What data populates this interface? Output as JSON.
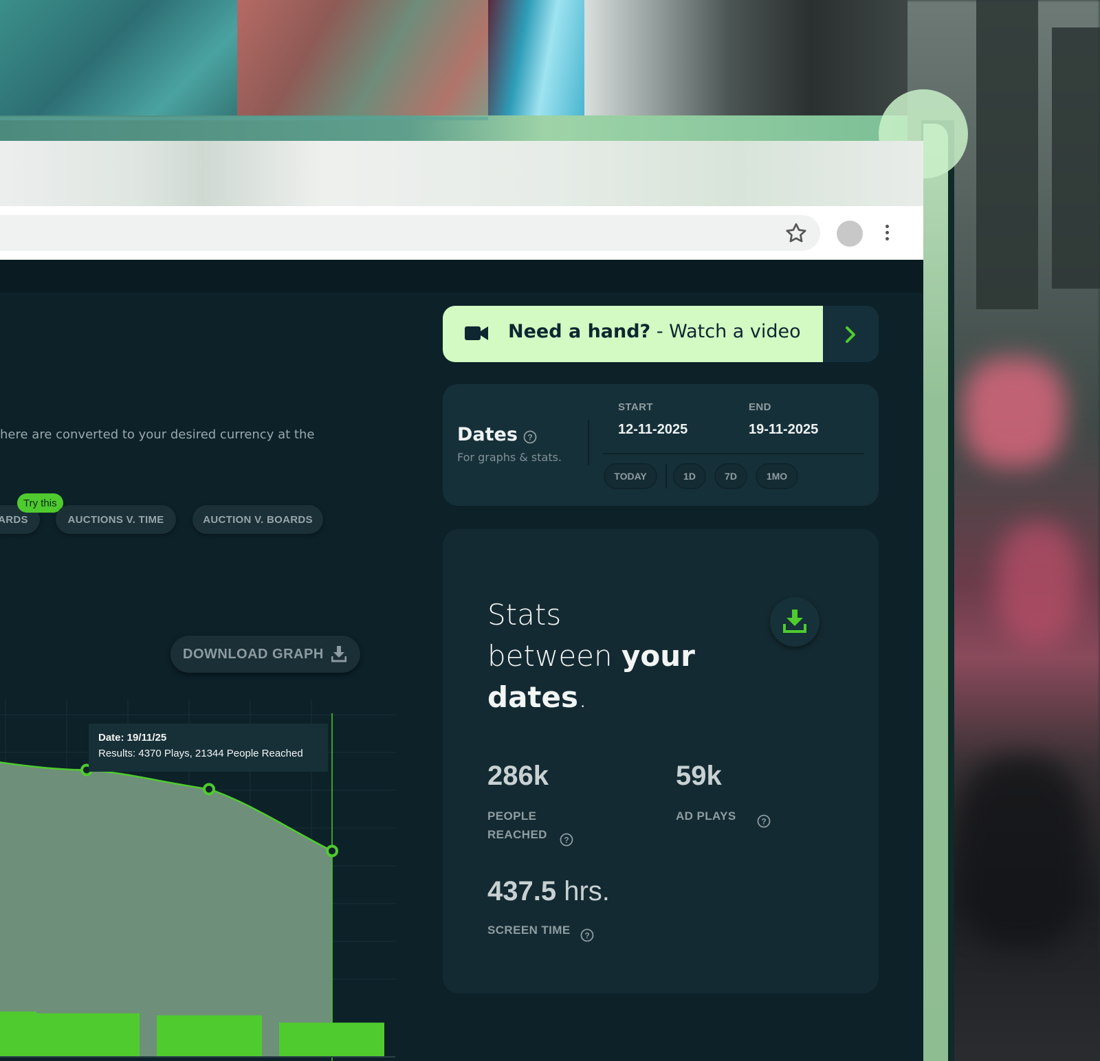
{
  "browser": {
    "icons": {
      "bookmark": "star-icon",
      "profile": "avatar",
      "menu": "kebab-icon"
    }
  },
  "analytics": {
    "currency_note": "here are converted to your desired currency at the",
    "try_badge": "Try this",
    "tabs": [
      {
        "label": "ARDS"
      },
      {
        "label": "AUCTIONS V. TIME"
      },
      {
        "label": "AUCTION V. BOARDS"
      }
    ],
    "download_graph_label": "DOWNLOAD GRAPH",
    "tooltip": {
      "line1": "Date: 19/11/25",
      "line2": "Results: 4370 Plays, 21344 People Reached"
    }
  },
  "help": {
    "bold": "Need a hand?",
    "rest": " - Watch a video",
    "icons": {
      "video": "video-camera-icon",
      "arrow": "chevron-right-icon"
    }
  },
  "dates": {
    "title": "Dates",
    "subtitle": "For graphs & stats.",
    "start_label": "START",
    "start_value": "12-11-2025",
    "end_label": "END",
    "end_value": "19-11-2025",
    "quick": [
      "TODAY",
      "1D",
      "7D",
      "1MO"
    ]
  },
  "stats": {
    "title_line1": "Stats",
    "title_line2_a": "between ",
    "title_line2_b": "your",
    "title_line3_a": "dates",
    "title_line3_b": ".",
    "people_reached": {
      "value": "286k",
      "label_line1": "PEOPLE",
      "label_line2": "REACHED"
    },
    "ad_plays": {
      "value": "59k",
      "label": "AD PLAYS"
    },
    "screen_time": {
      "value": "437.5",
      "unit": " hrs.",
      "label": "SCREEN TIME"
    }
  },
  "colors": {
    "accent_green": "#4fcb2f",
    "help_bg": "#d2fac2",
    "page_bg": "#0c2128",
    "card_bg": "#142a32"
  },
  "chart_data": {
    "type": "line",
    "note_visible_points": "partial view; only rightmost points visible",
    "series": [
      {
        "values": [
          21344,
          20400,
          19000,
          14500
        ]
      }
    ],
    "bars": [
      4370,
      4200,
      4000,
      3300
    ],
    "highlight_point_index": 3
  }
}
